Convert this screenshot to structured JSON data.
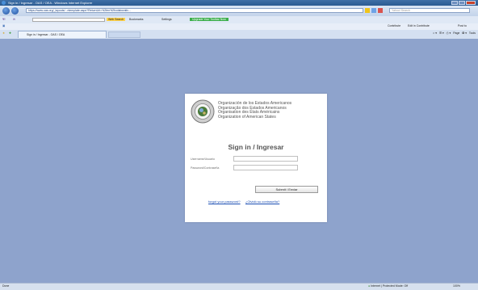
{
  "window": {
    "title": "Sign in / Ingresar - OAS / OEA - Windows Internet Explorer"
  },
  "address_bar": {
    "url": "https://www.oas.org/_layouts/...ntemplate.aspx?ReturnUrl=%2fen%2fcolaborativ...",
    "search_placeholder": "Yahoo! Search"
  },
  "toolbar": {
    "web_search_label": "Web Search",
    "bookmarks_label": "Bookmarks",
    "settings_label": "Settings",
    "upgrade_label": "Upgrade Your Toolbar Now",
    "contribute_label": "Contribute",
    "edit_in_contribute_label": "Edit in Contribute",
    "post_to_label": "Post to"
  },
  "tab": {
    "label": "Sign in / Ingresar - OAS / OEA"
  },
  "command_bar": {
    "page_label": "Page",
    "tools_label": "Tools"
  },
  "login": {
    "org_names": [
      "Organización de los Estados Americanos",
      "Organização dos Estados Americanos",
      "Organisation des États Américains",
      "Organization of American States"
    ],
    "heading": "Sign in / Ingresar",
    "username_label": "Username/Usuario",
    "password_label": "Password/Contraseña",
    "submit_label": "Submit / Enviar",
    "forgot_link": "forgot your password?",
    "olvido_link": "¿Olvidó su contraseña?"
  },
  "status_bar": {
    "left_text": "Done",
    "zone_text": "Internet | Protected Mode: Off",
    "zoom_text": "100%"
  },
  "colors": {
    "page_background": "#8ea3cc",
    "link": "#1a4db3",
    "title_bar": "#2b5a91"
  }
}
